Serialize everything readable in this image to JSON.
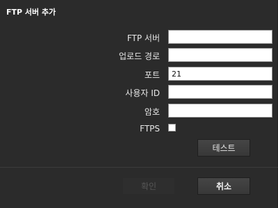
{
  "dialog": {
    "title": "FTP 서버 추가"
  },
  "form": {
    "ftp_server": {
      "label": "FTP 서버",
      "value": ""
    },
    "upload_path": {
      "label": "업로드 경로",
      "value": ""
    },
    "port": {
      "label": "포트",
      "value": "21"
    },
    "user_id": {
      "label": "사용자 ID",
      "value": ""
    },
    "password": {
      "label": "암호",
      "value": ""
    },
    "ftps": {
      "label": "FTPS",
      "checked": false
    }
  },
  "buttons": {
    "test": "테스트",
    "ok": "확인",
    "cancel": "취소"
  }
}
